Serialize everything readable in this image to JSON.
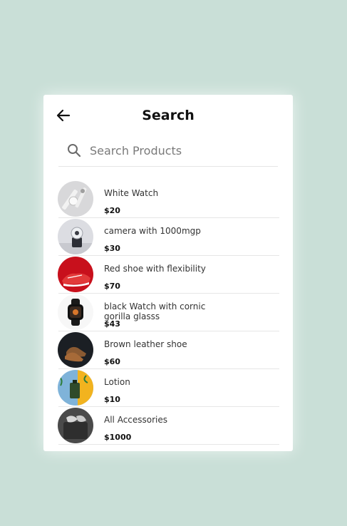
{
  "header": {
    "title": "Search"
  },
  "search": {
    "placeholder": "Search Products",
    "value": ""
  },
  "products": [
    {
      "name": "White Watch",
      "price": "$20",
      "image": "white-watch-image"
    },
    {
      "name": "camera with 1000mgp",
      "price": "$30",
      "image": "camera-image"
    },
    {
      "name": "Red shoe with flexibility",
      "price": "$70",
      "image": "red-shoe-image"
    },
    {
      "name": "black Watch with cornic gorilla glasss",
      "price": "$43",
      "image": "black-watch-image"
    },
    {
      "name": "Brown leather shoe",
      "price": "$60",
      "image": "brown-shoe-image"
    },
    {
      "name": "Lotion",
      "price": "$10",
      "image": "lotion-image"
    },
    {
      "name": "All Accessories",
      "price": "$1000",
      "image": "accessories-image"
    }
  ],
  "colors": {
    "background": "#c9dfd7",
    "card": "#ffffff",
    "divider": "#e6e6e6",
    "text": "#333333"
  }
}
